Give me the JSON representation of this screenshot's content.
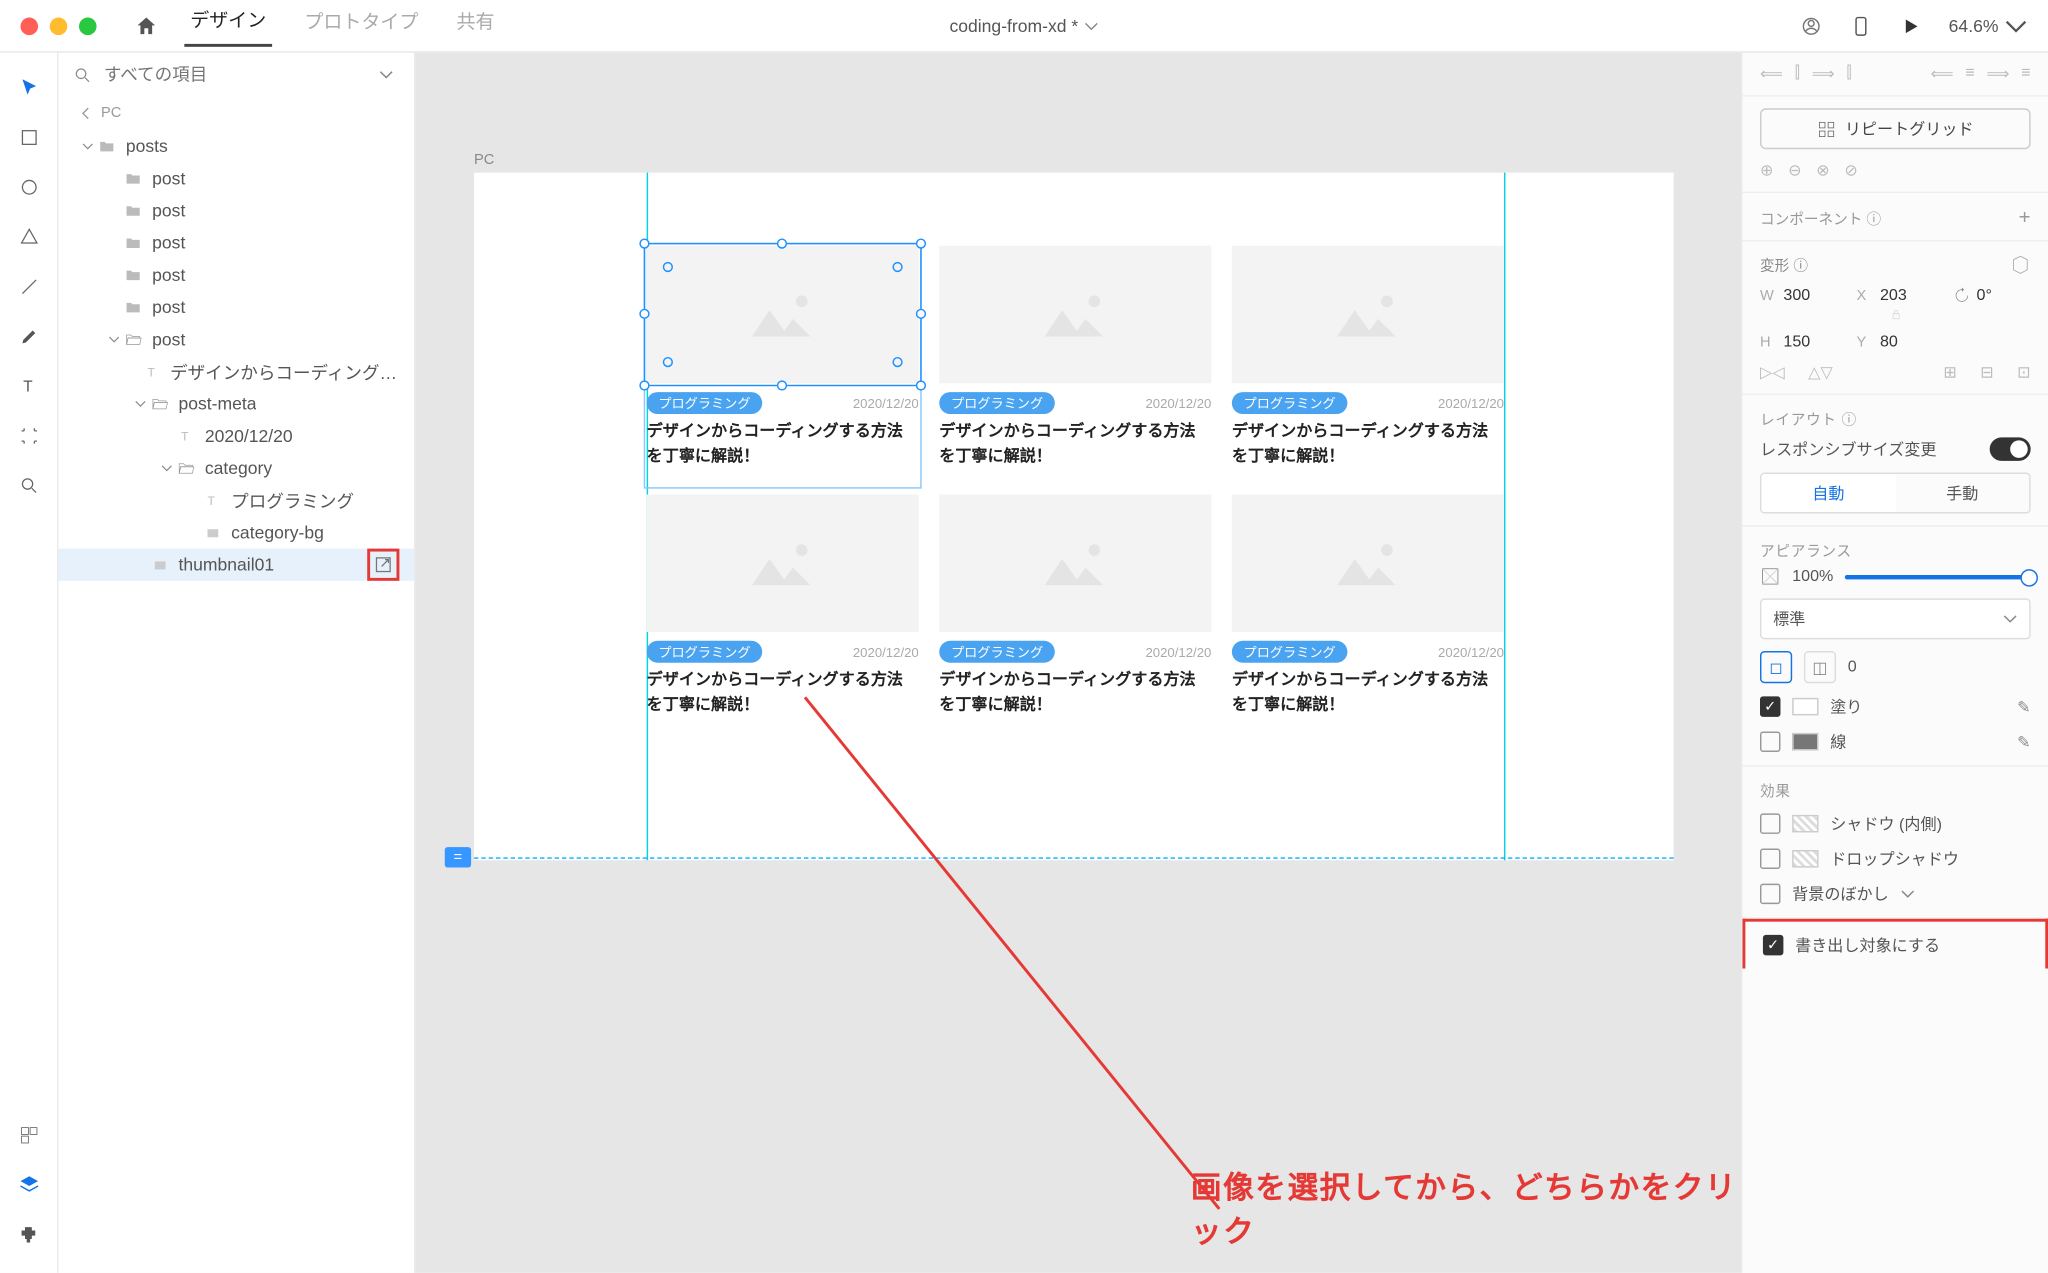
{
  "titlebar": {
    "tabs": {
      "design": "デザイン",
      "prototype": "プロトタイプ",
      "share": "共有"
    },
    "filename": "coding-from-xd *",
    "zoom": "64.6%"
  },
  "layers": {
    "search_placeholder": "すべての項目",
    "breadcrumb": "PC",
    "items": [
      {
        "label": "posts",
        "depth": 0,
        "icon": "folder",
        "caret": "down"
      },
      {
        "label": "post",
        "depth": 1,
        "icon": "folder"
      },
      {
        "label": "post",
        "depth": 1,
        "icon": "folder"
      },
      {
        "label": "post",
        "depth": 1,
        "icon": "folder"
      },
      {
        "label": "post",
        "depth": 1,
        "icon": "folder"
      },
      {
        "label": "post",
        "depth": 1,
        "icon": "folder"
      },
      {
        "label": "post",
        "depth": 1,
        "icon": "folder-open",
        "caret": "down"
      },
      {
        "label": "デザインからコーディングする方法…",
        "depth": 2,
        "icon": "text"
      },
      {
        "label": "post-meta",
        "depth": 2,
        "icon": "folder-open",
        "caret": "down"
      },
      {
        "label": "2020/12/20",
        "depth": 3,
        "icon": "text"
      },
      {
        "label": "category",
        "depth": 3,
        "icon": "folder-open",
        "caret": "down"
      },
      {
        "label": "プログラミング",
        "depth": 4,
        "icon": "text"
      },
      {
        "label": "category-bg",
        "depth": 4,
        "icon": "rect"
      },
      {
        "label": "thumbnail01",
        "depth": 2,
        "icon": "rect",
        "selected": true,
        "export": true
      }
    ]
  },
  "canvas": {
    "artboard_label": "PC",
    "card": {
      "badge": "プログラミング",
      "date": "2020/12/20",
      "title": "デザインからコーディングする方法を丁寧に解説！"
    },
    "annotation_text": "画像を選択してから、どちらかをクリック"
  },
  "props": {
    "repeat_grid": "リピートグリッド",
    "components": "コンポーネント",
    "transform": "変形",
    "w": "300",
    "x": "203",
    "h": "150",
    "y": "80",
    "rot": "0°",
    "layout": "レイアウト",
    "responsive": "レスポンシブサイズ変更",
    "auto": "自動",
    "manual": "手動",
    "appearance": "アピアランス",
    "opacity": "100%",
    "blend": "標準",
    "corner": "0",
    "fill": "塗り",
    "stroke": "線",
    "effects": "効果",
    "shadow_inner": "シャドウ (内側)",
    "drop_shadow": "ドロップシャドウ",
    "bg_blur": "背景のぼかし",
    "mark_export": "書き出し対象にする"
  }
}
